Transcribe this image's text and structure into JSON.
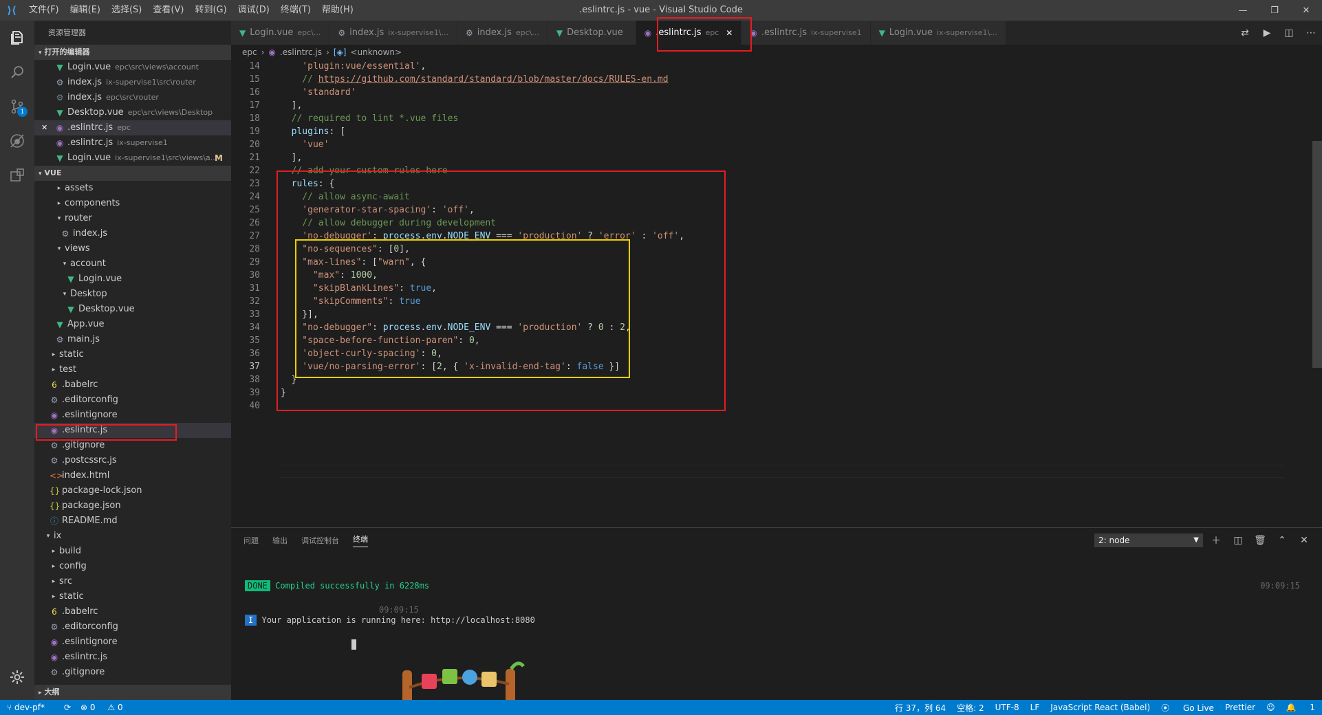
{
  "window": {
    "title": ".eslintrc.js - vue - Visual Studio Code",
    "menu": [
      "文件(F)",
      "编辑(E)",
      "选择(S)",
      "查看(V)",
      "转到(G)",
      "调试(D)",
      "终端(T)",
      "帮助(H)"
    ]
  },
  "sidebar": {
    "title": "资源管理器",
    "open_editors_label": "打开的编辑器",
    "open_editors": [
      {
        "name": "Login.vue",
        "desc": "epc\\src\\views\\account",
        "icon": "vue-icon"
      },
      {
        "name": "index.js",
        "desc": "ix-supervise1\\src\\router",
        "icon": "gear-icon"
      },
      {
        "name": "index.js",
        "desc": "epc\\src\\router",
        "icon": "js-icon"
      },
      {
        "name": "Desktop.vue",
        "desc": "epc\\src\\views\\Desktop",
        "icon": "vue-icon"
      },
      {
        "name": ".eslintrc.js",
        "desc": "epc",
        "icon": "eslint-icon",
        "close": "✕"
      },
      {
        "name": ".eslintrc.js",
        "desc": "ix-supervise1",
        "icon": "eslint-icon"
      },
      {
        "name": "Login.vue",
        "desc": "ix-supervise1\\src\\views\\a...",
        "icon": "vue-icon",
        "mod": "M"
      }
    ],
    "workspace_label": "VUE",
    "tree": [
      {
        "name": "assets",
        "indent": 1,
        "tw": "▸"
      },
      {
        "name": "components",
        "indent": 1,
        "tw": "▸"
      },
      {
        "name": "router",
        "indent": 1,
        "tw": "▾"
      },
      {
        "name": "index.js",
        "indent": 2,
        "icon": "gear"
      },
      {
        "name": "views",
        "indent": 1,
        "tw": "▾"
      },
      {
        "name": "account",
        "indent": 2,
        "tw": "▾"
      },
      {
        "name": "Login.vue",
        "indent": 3,
        "icon": "vue"
      },
      {
        "name": "Desktop",
        "indent": 2,
        "tw": "▾"
      },
      {
        "name": "Desktop.vue",
        "indent": 3,
        "icon": "vue"
      },
      {
        "name": "App.vue",
        "indent": 1,
        "icon": "vue"
      },
      {
        "name": "main.js",
        "indent": 1,
        "icon": "gear"
      },
      {
        "name": "static",
        "indent": 0,
        "tw": "▸"
      },
      {
        "name": "test",
        "indent": 0,
        "tw": "▸"
      },
      {
        "name": ".babelrc",
        "indent": 0,
        "icon": "babel"
      },
      {
        "name": ".editorconfig",
        "indent": 0,
        "icon": "gear"
      },
      {
        "name": ".eslintignore",
        "indent": 0,
        "icon": "eslint"
      },
      {
        "name": ".eslintrc.js",
        "indent": 0,
        "icon": "eslint",
        "selected": true
      },
      {
        "name": ".gitignore",
        "indent": 0,
        "icon": "gear"
      },
      {
        "name": ".postcssrc.js",
        "indent": 0,
        "icon": "gear"
      },
      {
        "name": "index.html",
        "indent": 0,
        "icon": "html"
      },
      {
        "name": "package-lock.json",
        "indent": 0,
        "icon": "json"
      },
      {
        "name": "package.json",
        "indent": 0,
        "icon": "json"
      },
      {
        "name": "README.md",
        "indent": 0,
        "icon": "info"
      },
      {
        "name": "ix",
        "indent": -1,
        "tw": "▾"
      },
      {
        "name": "build",
        "indent": 0,
        "tw": "▸"
      },
      {
        "name": "config",
        "indent": 0,
        "tw": "▸"
      },
      {
        "name": "src",
        "indent": 0,
        "tw": "▸"
      },
      {
        "name": "static",
        "indent": 0,
        "tw": "▸"
      },
      {
        "name": ".babelrc",
        "indent": 0,
        "icon": "babel"
      },
      {
        "name": ".editorconfig",
        "indent": 0,
        "icon": "gear"
      },
      {
        "name": ".eslintignore",
        "indent": 0,
        "icon": "eslint"
      },
      {
        "name": ".eslintrc.js",
        "indent": 0,
        "icon": "eslint"
      },
      {
        "name": ".gitignore",
        "indent": 0,
        "icon": "gear"
      }
    ],
    "outline_label": "大纲"
  },
  "tabs": [
    {
      "name": "Login.vue",
      "desc": "epc\\...",
      "icon": "vue"
    },
    {
      "name": "index.js",
      "desc": "ix-supervise1\\...",
      "icon": "gear"
    },
    {
      "name": "index.js",
      "desc": "epc\\...",
      "icon": "gear"
    },
    {
      "name": "Desktop.vue",
      "desc": "",
      "icon": "vue"
    },
    {
      "name": ".eslintrc.js",
      "desc": "epc",
      "icon": "eslint",
      "active": true,
      "close": "✕"
    },
    {
      "name": ".eslintrc.js",
      "desc": "ix-supervise1",
      "icon": "eslint"
    },
    {
      "name": "Login.vue",
      "desc": "ix-supervise1\\...",
      "icon": "vue"
    }
  ],
  "breadcrumb": {
    "folder": "epc",
    "file": ".eslintrc.js",
    "symbol": "<unknown>"
  },
  "editor": {
    "current_line": 37,
    "lines": [
      {
        "n": 14,
        "tokens": [
          [
            "s",
            "    'plugin:vue/essential'"
          ],
          [
            "w",
            ","
          ]
        ]
      },
      {
        "n": 15,
        "tokens": [
          [
            "c",
            "    // "
          ],
          [
            "u",
            "https://github.com/standard/standard/blob/master/docs/RULES-en.md"
          ]
        ]
      },
      {
        "n": 16,
        "tokens": [
          [
            "s",
            "    'standard'"
          ]
        ]
      },
      {
        "n": 17,
        "tokens": [
          [
            "w",
            "  ],"
          ]
        ]
      },
      {
        "n": 18,
        "tokens": [
          [
            "c",
            "  // required to lint *.vue files"
          ]
        ]
      },
      {
        "n": 19,
        "tokens": [
          [
            "p",
            "  plugins"
          ],
          [
            "w",
            ": ["
          ]
        ]
      },
      {
        "n": 20,
        "tokens": [
          [
            "s",
            "    'vue'"
          ]
        ]
      },
      {
        "n": 21,
        "tokens": [
          [
            "w",
            "  ],"
          ]
        ]
      },
      {
        "n": 22,
        "tokens": [
          [
            "c",
            "  // add your custom rules here"
          ]
        ]
      },
      {
        "n": 23,
        "tokens": [
          [
            "p",
            "  rules"
          ],
          [
            "w",
            ": {"
          ]
        ]
      },
      {
        "n": 24,
        "tokens": [
          [
            "c",
            "    // allow async-await"
          ]
        ]
      },
      {
        "n": 25,
        "tokens": [
          [
            "s",
            "    'generator-star-spacing'"
          ],
          [
            "w",
            ": "
          ],
          [
            "s",
            "'off'"
          ],
          [
            "w",
            ","
          ]
        ]
      },
      {
        "n": 26,
        "tokens": [
          [
            "c",
            "    // allow debugger during development"
          ]
        ]
      },
      {
        "n": 27,
        "tokens": [
          [
            "s",
            "    'no-debugger'"
          ],
          [
            "w",
            ": "
          ],
          [
            "p",
            "process"
          ],
          [
            "w",
            "."
          ],
          [
            "p",
            "env"
          ],
          [
            "w",
            "."
          ],
          [
            "p",
            "NODE_ENV"
          ],
          [
            "w",
            " === "
          ],
          [
            "s",
            "'production'"
          ],
          [
            "w",
            " ? "
          ],
          [
            "s",
            "'error'"
          ],
          [
            "w",
            " : "
          ],
          [
            "s",
            "'off'"
          ],
          [
            "w",
            ","
          ]
        ]
      },
      {
        "n": 28,
        "tokens": [
          [
            "s",
            "    \"no-sequences\""
          ],
          [
            "w",
            ": ["
          ],
          [
            "n",
            "0"
          ],
          [
            "w",
            "],"
          ]
        ]
      },
      {
        "n": 29,
        "tokens": [
          [
            "s",
            "    \"max-lines\""
          ],
          [
            "w",
            ": ["
          ],
          [
            "s",
            "\"warn\""
          ],
          [
            "w",
            ", {"
          ]
        ]
      },
      {
        "n": 30,
        "tokens": [
          [
            "s",
            "      \"max\""
          ],
          [
            "w",
            ": "
          ],
          [
            "n",
            "1000"
          ],
          [
            "w",
            ","
          ]
        ]
      },
      {
        "n": 31,
        "tokens": [
          [
            "s",
            "      \"skipBlankLines\""
          ],
          [
            "w",
            ": "
          ],
          [
            "k",
            "true"
          ],
          [
            "w",
            ","
          ]
        ]
      },
      {
        "n": 32,
        "tokens": [
          [
            "s",
            "      \"skipComments\""
          ],
          [
            "w",
            ": "
          ],
          [
            "k",
            "true"
          ]
        ]
      },
      {
        "n": 33,
        "tokens": [
          [
            "w",
            "    }],"
          ]
        ]
      },
      {
        "n": 34,
        "tokens": [
          [
            "s",
            "    \"no-debugger\""
          ],
          [
            "w",
            ": "
          ],
          [
            "p",
            "process"
          ],
          [
            "w",
            "."
          ],
          [
            "p",
            "env"
          ],
          [
            "w",
            "."
          ],
          [
            "p",
            "NODE_ENV"
          ],
          [
            "w",
            " === "
          ],
          [
            "s",
            "'production'"
          ],
          [
            "w",
            " ? "
          ],
          [
            "n",
            "0"
          ],
          [
            "w",
            " : "
          ],
          [
            "n",
            "2"
          ],
          [
            "w",
            ","
          ]
        ]
      },
      {
        "n": 35,
        "tokens": [
          [
            "s",
            "    \"space-before-function-paren\""
          ],
          [
            "w",
            ": "
          ],
          [
            "n",
            "0"
          ],
          [
            "w",
            ","
          ]
        ]
      },
      {
        "n": 36,
        "tokens": [
          [
            "s",
            "    'object-curly-spacing'"
          ],
          [
            "w",
            ": "
          ],
          [
            "n",
            "0"
          ],
          [
            "w",
            ","
          ]
        ]
      },
      {
        "n": 37,
        "tokens": [
          [
            "s",
            "    'vue/no-parsing-error'"
          ],
          [
            "w",
            ": ["
          ],
          [
            "n",
            "2"
          ],
          [
            "w",
            ", { "
          ],
          [
            "s",
            "'x-invalid-end-tag'"
          ],
          [
            "w",
            ": "
          ],
          [
            "k",
            "false"
          ],
          [
            "w",
            " }]"
          ]
        ]
      },
      {
        "n": 38,
        "tokens": [
          [
            "w",
            "  }"
          ]
        ]
      },
      {
        "n": 39,
        "tokens": [
          [
            "w",
            "}"
          ]
        ]
      },
      {
        "n": 40,
        "tokens": []
      }
    ]
  },
  "panel": {
    "tabs": [
      "问题",
      "输出",
      "调试控制台",
      "终端"
    ],
    "active_tab": "终端",
    "terminal_select": "2: node",
    "terminal": {
      "done_badge": "DONE",
      "compiled": "Compiled successfully in 6228ms",
      "time_right": "09:09:15",
      "time_mid": "09:09:15",
      "info_badge": "I",
      "running": "Your application is running here: http://localhost:8080"
    }
  },
  "statusbar": {
    "branch": "dev-pf*",
    "errors": "0",
    "warnings": "0",
    "position": "行 37，列 64",
    "spaces": "空格: 2",
    "encoding": "UTF-8",
    "eol": "LF",
    "language": "JavaScript React (Babel)",
    "golive": "Go Live",
    "prettier": "Prettier",
    "notifications": "1"
  },
  "colors": {
    "accent": "#007acc",
    "highlight_red": "#e51c23",
    "highlight_yellow": "#f0d000"
  }
}
